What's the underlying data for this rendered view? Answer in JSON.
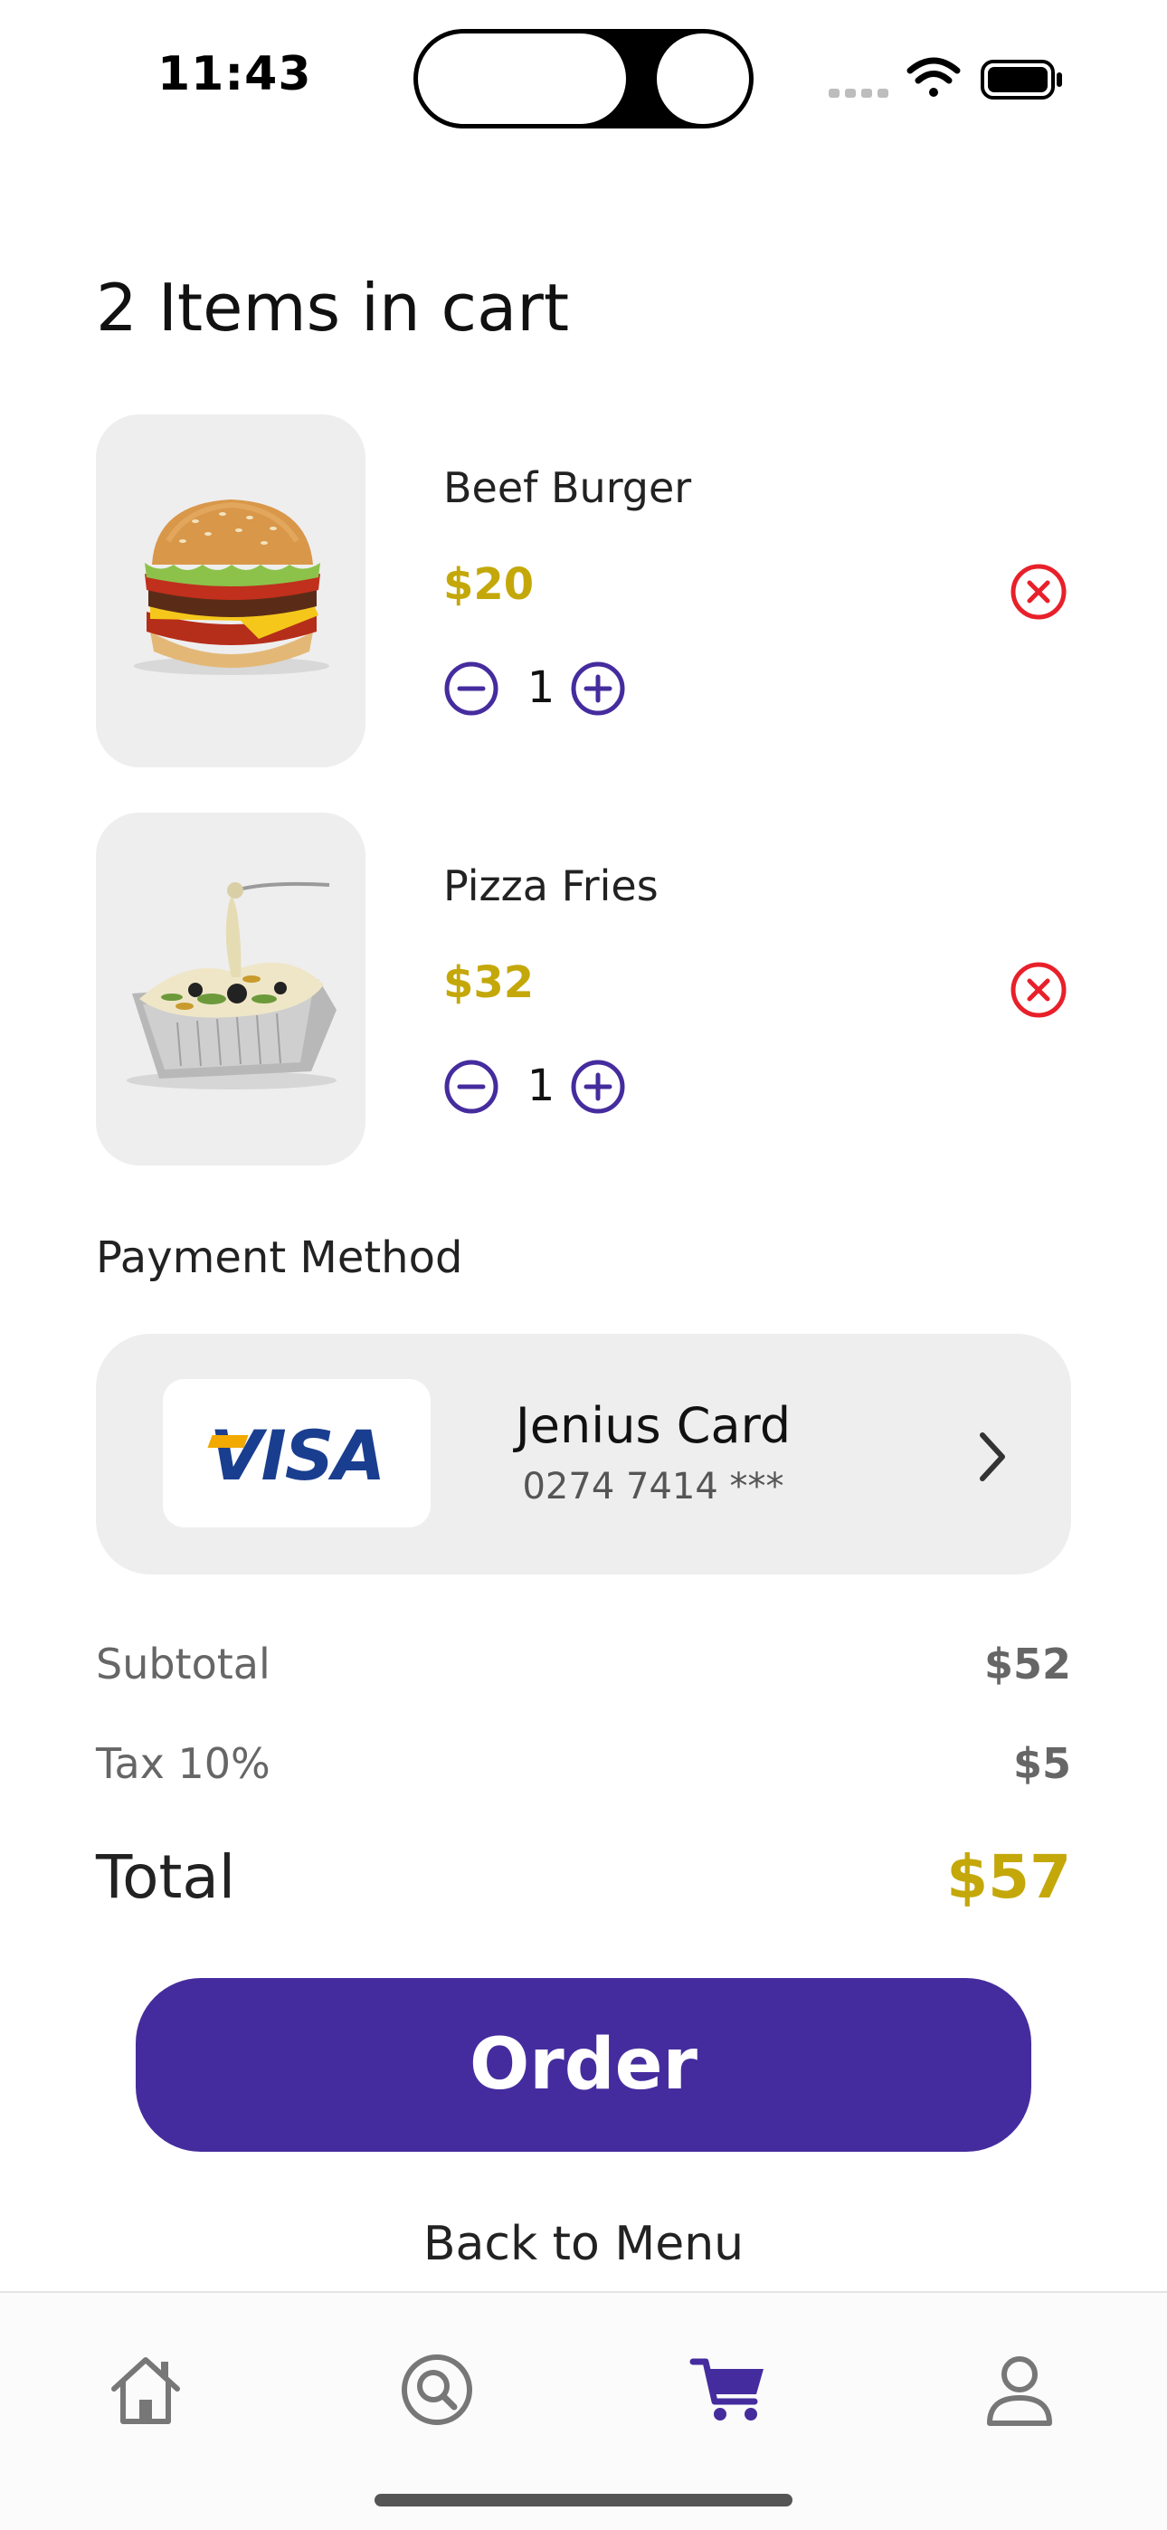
{
  "status_bar": {
    "time": "11:43"
  },
  "cart": {
    "title": "2 Items in cart",
    "items": [
      {
        "name": "Beef Burger",
        "price": "$20",
        "quantity": "1"
      },
      {
        "name": "Pizza Fries",
        "price": "$32",
        "quantity": "1"
      }
    ]
  },
  "payment": {
    "section_label": "Payment Method",
    "card_brand": "VISA",
    "card_name": "Jenius Card",
    "card_number": "0274 7414 ***"
  },
  "summary": {
    "subtotal_label": "Subtotal",
    "subtotal_value": "$52",
    "tax_label": "Tax 10%",
    "tax_value": "$5",
    "total_label": "Total",
    "total_value": "$57"
  },
  "actions": {
    "order_label": "Order",
    "back_label": "Back to Menu"
  },
  "tab_bar": {
    "tabs": [
      {
        "icon": "home-icon",
        "active": false
      },
      {
        "icon": "search-icon",
        "active": false
      },
      {
        "icon": "cart-icon",
        "active": true
      },
      {
        "icon": "profile-icon",
        "active": false
      }
    ]
  },
  "colors": {
    "accent": "#452c9e",
    "price": "#c4a80a",
    "remove": "#e8202a",
    "card_background": "#eeeeee"
  }
}
